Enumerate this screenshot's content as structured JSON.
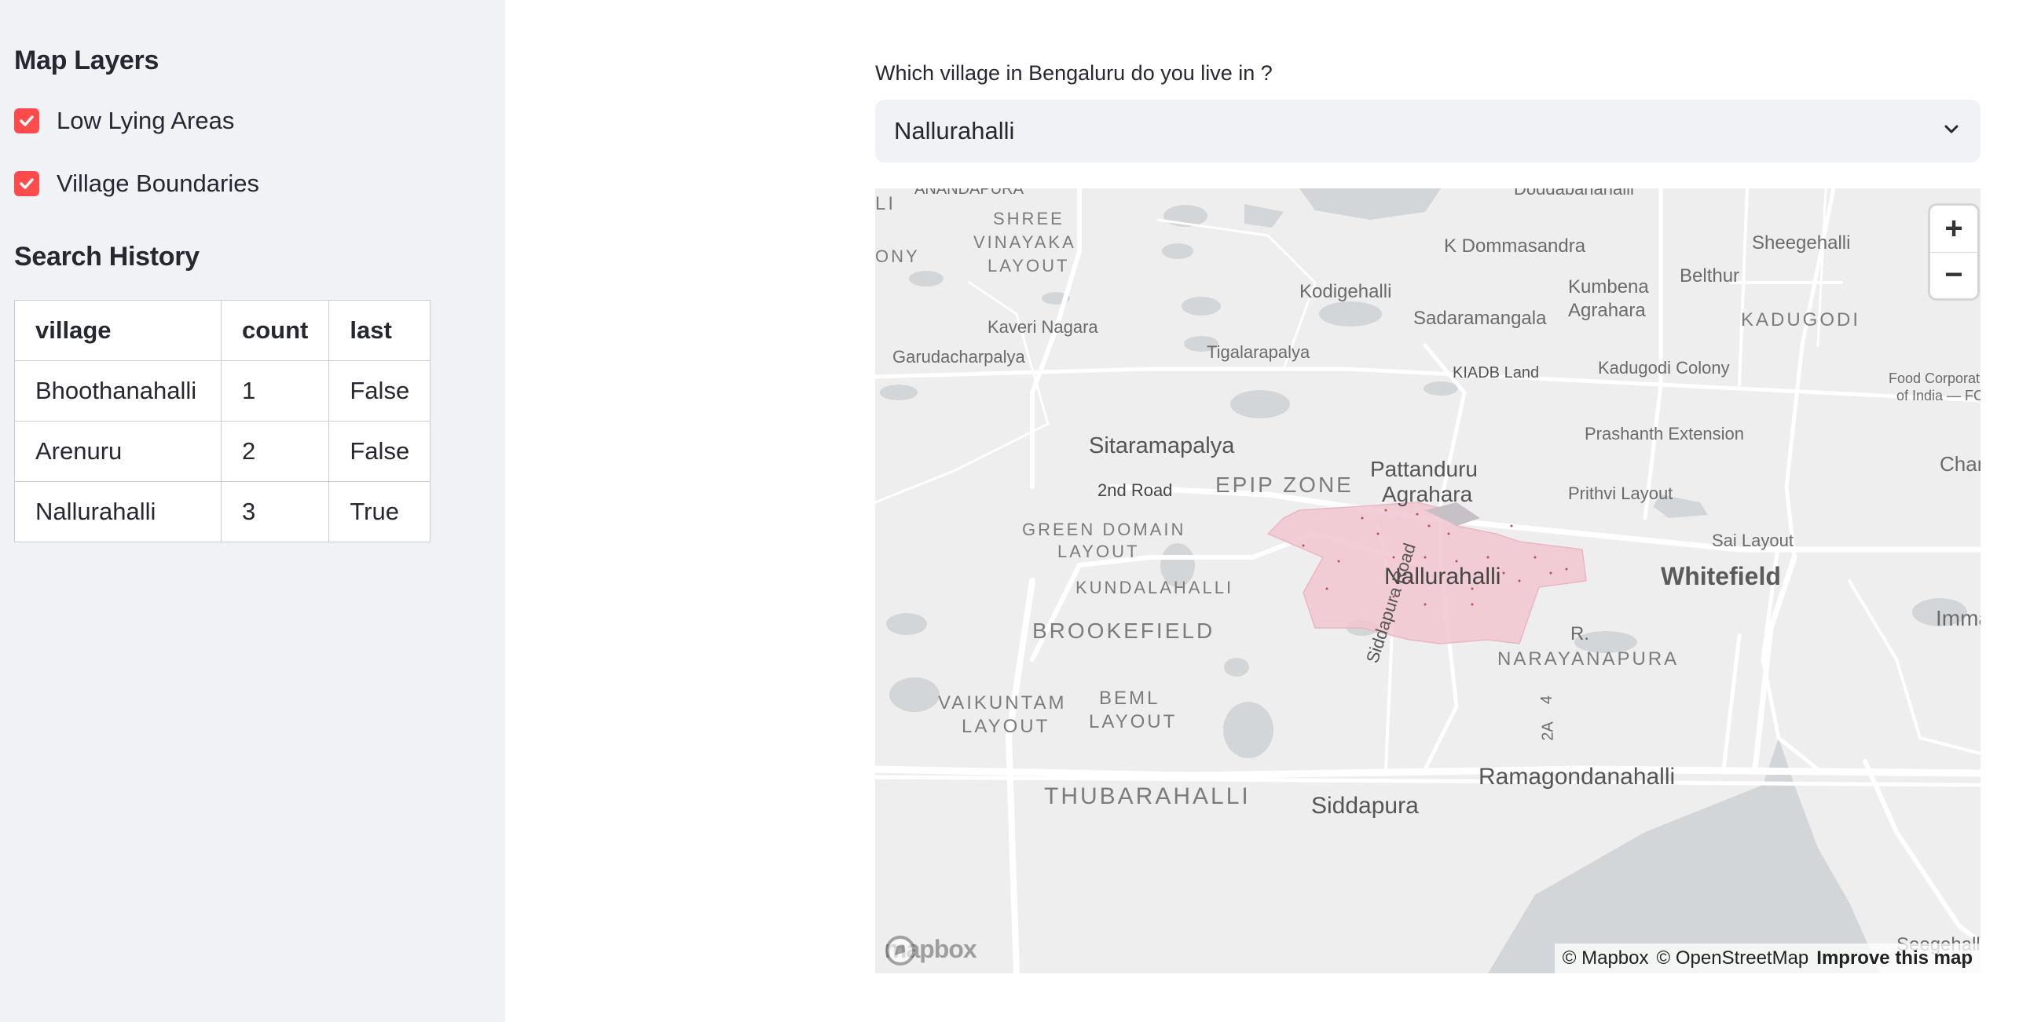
{
  "sidebar": {
    "map_layers_title": "Map Layers",
    "layers": [
      {
        "label": "Low Lying Areas",
        "checked": true
      },
      {
        "label": "Village Boundaries",
        "checked": true
      }
    ],
    "search_history_title": "Search History",
    "history_table": {
      "headers": [
        "village",
        "count",
        "last"
      ],
      "rows": [
        [
          "Bhoothanahalli",
          "1",
          "False"
        ],
        [
          "Arenuru",
          "2",
          "False"
        ],
        [
          "Nallurahalli",
          "3",
          "True"
        ]
      ]
    }
  },
  "main": {
    "select_label": "Which village in Bengaluru do you live in ?",
    "selected_village": "Nallurahalli"
  },
  "map": {
    "zoom_in": "+",
    "zoom_out": "−",
    "attribution_mapbox": "© Mapbox",
    "attribution_osm": "© OpenStreetMap",
    "improve_link": "Improve this map",
    "logo_text": "mapbox",
    "labels": {
      "anandapura": "ANANDAPURA",
      "doddabanahalli": "Doddabanahalli",
      "ll": "LI",
      "shree": "SHREE",
      "vinayaka": "VINAYAKA",
      "layout1": "LAYOUT",
      "ony": "ONY",
      "k_dommasandra": "K Dommasandra",
      "sheegehalli": "Sheegehalli",
      "kumbena": "Kumbena",
      "agrahara1": "Agrahara",
      "belthur": "Belthur",
      "kodigehalli": "Kodigehalli",
      "sadaramangala": "Sadaramangala",
      "kadugodi": "KADUGODI",
      "kaveri_nagara": "Kaveri Nagara",
      "garudacharpalya": "Garudacharpalya",
      "tigalarapalya": "Tigalarapalya",
      "kiadb_land": "KIADB Land",
      "kadugodi_colony": "Kadugodi Colony",
      "food_corp1": "Food Corporati",
      "food_corp2": "of India — FC",
      "prashanth_ext": "Prashanth Extension",
      "sitaramapalya": "Sitaramapalya",
      "chann": "Chann",
      "pattanduru": "Pattanduru",
      "agrahara2": "Agrahara",
      "second_road": "2nd Road",
      "epip_zone": "EPIP ZONE",
      "prithvi_layout": "Prithvi Layout",
      "green_domain": "GREEN DOMAIN",
      "layout2": "LAYOUT",
      "sai_layout": "Sai Layout",
      "nallurahalli": "Nallurahalli",
      "whitefield": "Whitefield",
      "kundalahalli": "KUNDALAHALLI",
      "immad": "Immad",
      "brookefield": "BROOKEFIELD",
      "siddapura_road": "Siddapura Road",
      "r": "R.",
      "narayanapura": "NARAYANAPURA",
      "vaikuntam": "VAIKUNTAM",
      "layout3": "LAYOUT",
      "beml": "BEML",
      "layout4": "LAYOUT",
      "four": "4",
      "two_a": "2A",
      "ramagondanahalli": "Ramagondanahalli",
      "thubarahalli": "THUBARAHALLI",
      "siddapura": "Siddapura",
      "seegehalli_bottom": "Seegehalli"
    }
  }
}
